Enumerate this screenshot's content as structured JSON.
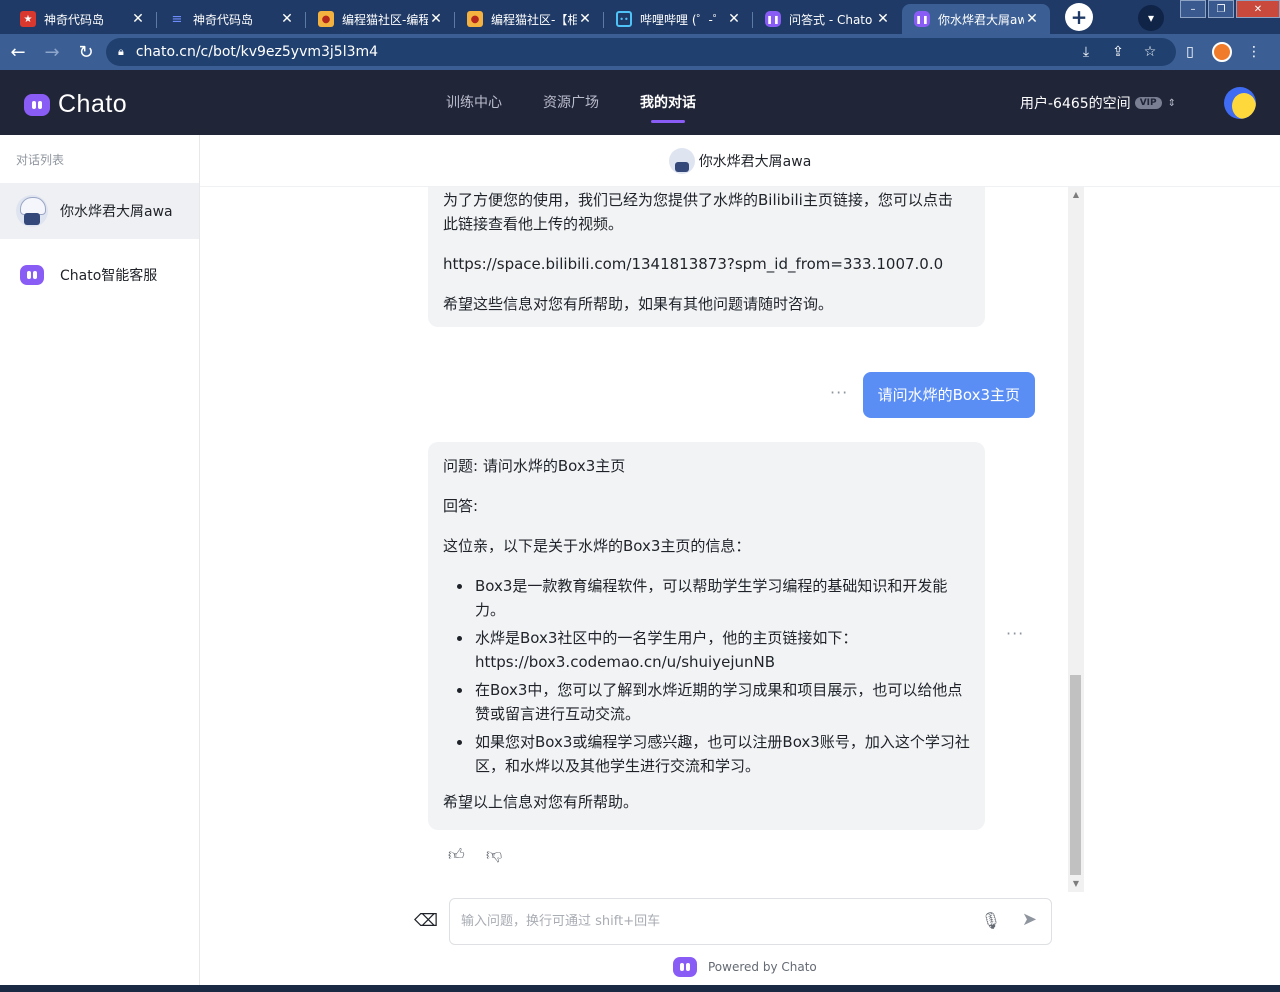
{
  "browser": {
    "tabs": [
      {
        "title": "神奇代码岛",
        "favicon": "star-badge-icon",
        "active": false
      },
      {
        "title": "神奇代码岛",
        "favicon": "lines-icon",
        "active": false
      },
      {
        "title": "编程猫社区-编程",
        "favicon": "cat-icon",
        "active": false
      },
      {
        "title": "编程猫社区-【相",
        "favicon": "cat-icon",
        "active": false
      },
      {
        "title": "哔哩哔哩 (゜-゜",
        "favicon": "tv-icon",
        "active": false
      },
      {
        "title": "问答式 - Chato",
        "favicon": "chato-icon",
        "active": false
      },
      {
        "title": "你水烨君大屑awa",
        "favicon": "chato-icon",
        "active": true
      }
    ],
    "url": "chato.cn/c/bot/kv9ez5yvm3j5l3m4"
  },
  "app": {
    "logo_text": "Chato",
    "nav": [
      {
        "label": "训练中心",
        "active": false
      },
      {
        "label": "资源广场",
        "active": false
      },
      {
        "label": "我的对话",
        "active": true
      }
    ],
    "space_label": "用户-6465的空间",
    "vip_badge": "VIP"
  },
  "sidebar": {
    "heading": "对话列表",
    "items": [
      {
        "label": "你水烨君大屑awa",
        "selected": true
      },
      {
        "label": "Chato智能客服",
        "selected": false
      }
    ]
  },
  "chat": {
    "title": "你水烨君大屑awa",
    "msg1": {
      "line1": "为了方便您的使用，我们已经为您提供了水烨的Bilibili主页链接，您可以点击此链接查看他上传的视频。",
      "link": "https://space.bilibili.com/1341813873?spm_id_from=333.1007.0.0",
      "closing": "希望这些信息对您有所帮助，如果有其他问题请随时咨询。"
    },
    "user_msg": "请问水烨的Box3主页",
    "msg2": {
      "question": "问题: 请问水烨的Box3主页",
      "answer_label": "回答:",
      "intro": "这位亲，以下是关于水烨的Box3主页的信息：",
      "bullets": [
        "Box3是一款教育编程软件，可以帮助学生学习编程的基础知识和开发能力。",
        "水烨是Box3社区中的一名学生用户，他的主页链接如下：https://box3.codemao.cn/u/shuiyejunNB",
        "在Box3中，您可以了解到水烨近期的学习成果和项目展示，也可以给他点赞或留言进行互动交流。",
        "如果您对Box3或编程学习感兴趣，也可以注册Box3账号，加入这个学习社区，和水烨以及其他学生进行交流和学习。"
      ],
      "closing": "希望以上信息对您有所帮助。"
    },
    "more_glyph": "···"
  },
  "composer": {
    "placeholder": "输入问题，换行可通过 shift+回车",
    "powered_by": "Powered by Chato"
  },
  "colors": {
    "brand_purple": "#8a5cf6",
    "user_bubble": "#5b8ef5",
    "header_bg": "#212538",
    "browser_frame": "#1f3a66"
  }
}
